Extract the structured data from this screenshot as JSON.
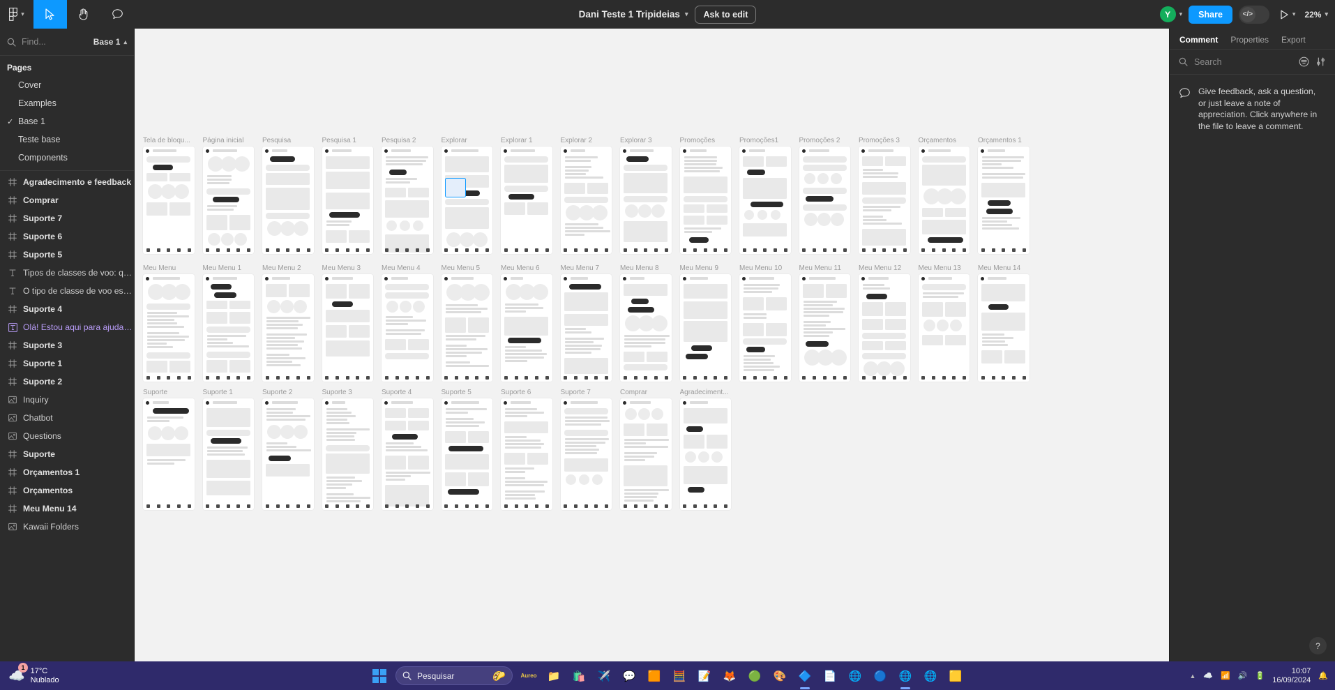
{
  "app": {
    "name": "Figma",
    "zoom": "22%"
  },
  "topbar": {
    "logo_icon": "figma-logo-icon",
    "tools": [
      {
        "name": "move-tool",
        "icon": "cursor-icon",
        "active": true
      },
      {
        "name": "hand-tool",
        "icon": "hand-icon",
        "active": false
      },
      {
        "name": "comment-tool",
        "icon": "comment-bubble-icon",
        "active": false
      }
    ],
    "document_title": "Dani Teste 1 Tripideias",
    "ask_to_edit": "Ask to edit",
    "avatar_initial": "Y",
    "share_label": "Share",
    "dev_mode_icon": "code-icon",
    "present_icon": "play-icon",
    "zoom_label": "22%",
    "accent": "#0d99ff",
    "avatar_color": "#14ae5c"
  },
  "left_panel": {
    "search_placeholder": "Find...",
    "page_selector": "Base 1",
    "pages_title": "Pages",
    "pages": [
      {
        "label": "Cover",
        "selected": false
      },
      {
        "label": "Examples",
        "selected": false
      },
      {
        "label": "Base 1",
        "selected": true
      },
      {
        "label": "Teste base",
        "selected": false
      },
      {
        "label": "Components",
        "selected": false
      }
    ],
    "layers": [
      {
        "label": "Agradecimento e feedback",
        "icon": "frame-icon",
        "type": "frame"
      },
      {
        "label": "Comprar",
        "icon": "frame-icon",
        "type": "frame"
      },
      {
        "label": "Suporte 7",
        "icon": "frame-icon",
        "type": "frame"
      },
      {
        "label": "Suporte 6",
        "icon": "frame-icon",
        "type": "frame"
      },
      {
        "label": "Suporte 5",
        "icon": "frame-icon",
        "type": "frame"
      },
      {
        "label": "Tipos de classes de voo: quais são?",
        "icon": "text-icon",
        "type": "text"
      },
      {
        "label": "O tipo de classe de voo está relaci...",
        "icon": "text-icon",
        "type": "text"
      },
      {
        "label": "Suporte 4",
        "icon": "frame-icon",
        "type": "frame"
      },
      {
        "label": "Olá! Estou aqui para ajudar você n...",
        "icon": "component-text-icon",
        "type": "component"
      },
      {
        "label": "Suporte 3",
        "icon": "frame-icon",
        "type": "frame"
      },
      {
        "label": "Suporte 1",
        "icon": "frame-icon",
        "type": "frame"
      },
      {
        "label": "Suporte 2",
        "icon": "frame-icon",
        "type": "frame"
      },
      {
        "label": "Inquiry",
        "icon": "image-icon",
        "type": "image"
      },
      {
        "label": "Chatbot",
        "icon": "image-icon",
        "type": "image"
      },
      {
        "label": "Questions",
        "icon": "image-icon",
        "type": "image"
      },
      {
        "label": "Suporte",
        "icon": "frame-icon",
        "type": "frame"
      },
      {
        "label": "Orçamentos 1",
        "icon": "frame-icon",
        "type": "frame"
      },
      {
        "label": "Orçamentos",
        "icon": "frame-icon",
        "type": "frame"
      },
      {
        "label": "Meu Menu 14",
        "icon": "frame-icon",
        "type": "frame"
      },
      {
        "label": "Kawaii Folders",
        "icon": "image-icon",
        "type": "image"
      }
    ]
  },
  "right_panel": {
    "tabs": [
      {
        "label": "Comment",
        "active": true
      },
      {
        "label": "Properties",
        "active": false
      },
      {
        "label": "Export",
        "active": false
      }
    ],
    "search_placeholder": "Search",
    "filter_icon": "filter-icon",
    "sort_icon": "sliders-icon",
    "empty_message": "Give feedback, ask a question, or just leave a note of appreciation. Click anywhere in the file to leave a comment.",
    "help_label": "?"
  },
  "canvas": {
    "rows": [
      {
        "name": "row-1",
        "frames": [
          "Tela de bloqu...",
          "Página inicial",
          "Pesquisa",
          "Pesquisa 1",
          "Pesquisa 2",
          "Explorar",
          "Explorar 1",
          "Explorar 2",
          "Explorar 3",
          "Promoções",
          "Promoções1",
          "Promoções 2",
          "Promoções 3",
          "Orçamentos",
          "Orçamentos 1"
        ],
        "selected_index": 5
      },
      {
        "name": "row-2",
        "frames": [
          "Meu Menu",
          "Meu Menu 1",
          "Meu Menu 2",
          "Meu Menu 3",
          "Meu Menu 4",
          "Meu Menu 5",
          "Meu Menu 6",
          "Meu Menu 7",
          "Meu Menu 8",
          "Meu Menu 9",
          "Meu Menu 10",
          "Meu Menu 11",
          "Meu Menu 12",
          "Meu Menu 13",
          "Meu Menu 14"
        ],
        "selected_index": -1
      },
      {
        "name": "row-3",
        "frames": [
          "Suporte",
          "Suporte 1",
          "Suporte 2",
          "Suporte 3",
          "Suporte 4",
          "Suporte 5",
          "Suporte 6",
          "Suporte 7",
          "Comprar",
          "Agradeciment..."
        ],
        "selected_index": -1
      }
    ]
  },
  "taskbar": {
    "weather_temp": "17°C",
    "weather_desc": "Nublado",
    "weather_badge": "1",
    "search_placeholder": "Pesquisar",
    "apps": [
      {
        "name": "start-button",
        "icon": "windows-logo-icon"
      },
      {
        "name": "taskbar-search",
        "icon": "search-icon"
      },
      {
        "name": "app-brand",
        "icon": "brand-icon"
      },
      {
        "name": "file-explorer",
        "icon": "folder-icon"
      },
      {
        "name": "microsoft-store",
        "icon": "store-icon"
      },
      {
        "name": "telegram",
        "icon": "telegram-icon"
      },
      {
        "name": "whatsapp",
        "icon": "whatsapp-icon"
      },
      {
        "name": "office",
        "icon": "office-icon"
      },
      {
        "name": "calculator",
        "icon": "calculator-icon"
      },
      {
        "name": "notepad",
        "icon": "notepad-icon"
      },
      {
        "name": "firefox",
        "icon": "firefox-icon"
      },
      {
        "name": "spotify",
        "icon": "spotify-icon"
      },
      {
        "name": "figma-desktop",
        "icon": "figma-icon"
      },
      {
        "name": "canva",
        "icon": "canva-icon"
      },
      {
        "name": "word",
        "icon": "word-icon"
      },
      {
        "name": "chrome-1",
        "icon": "chrome-icon"
      },
      {
        "name": "chrome-2",
        "icon": "chrome-icon"
      },
      {
        "name": "edge",
        "icon": "edge-icon"
      },
      {
        "name": "chrome-3",
        "icon": "chrome-icon"
      },
      {
        "name": "vscode",
        "icon": "vscode-icon"
      }
    ],
    "clock_time": "10:07",
    "clock_date": "16/09/2024"
  }
}
